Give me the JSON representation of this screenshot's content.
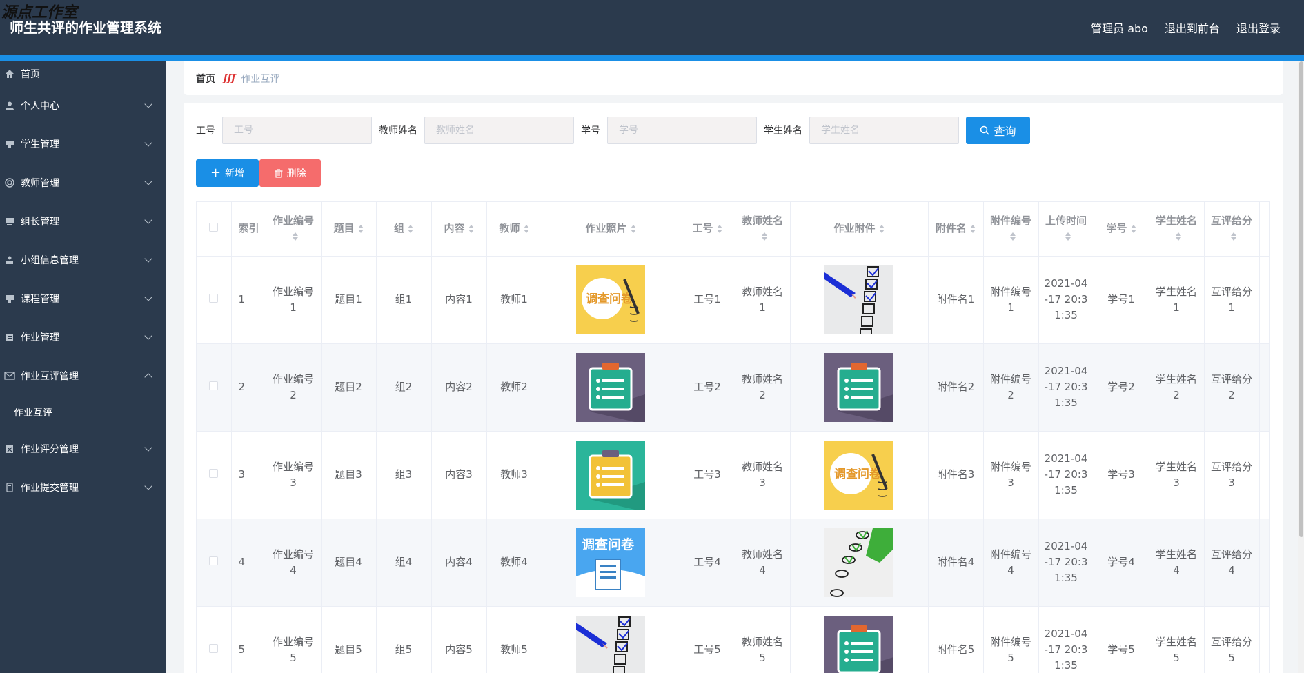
{
  "header": {
    "watermark": "源点工作室",
    "title": "师生共评的作业管理系统",
    "user": "管理员 abo",
    "to_front": "退出到前台",
    "logout": "退出登录"
  },
  "sidebar": {
    "items": [
      {
        "label": "首页",
        "icon": "home-icon"
      },
      {
        "label": "个人中心",
        "icon": "user-icon"
      },
      {
        "label": "学生管理",
        "icon": "student-icon"
      },
      {
        "label": "教师管理",
        "icon": "teacher-icon"
      },
      {
        "label": "组长管理",
        "icon": "group-leader-icon"
      },
      {
        "label": "小组信息管理",
        "icon": "group-info-icon"
      },
      {
        "label": "课程管理",
        "icon": "course-icon"
      },
      {
        "label": "作业管理",
        "icon": "homework-icon"
      },
      {
        "label": "作业互评管理",
        "icon": "mail-icon"
      },
      {
        "label": "作业互评",
        "icon": ""
      },
      {
        "label": "作业评分管理",
        "icon": "score-icon"
      },
      {
        "label": "作业提交管理",
        "icon": "submit-icon"
      }
    ]
  },
  "breadcrumb": {
    "home": "首页",
    "current": "作业互评"
  },
  "search": {
    "gonghao_label": "工号",
    "gonghao_placeholder": "工号",
    "teacher_label": "教师姓名",
    "teacher_placeholder": "教师姓名",
    "xuehao_label": "学号",
    "xuehao_placeholder": "学号",
    "student_label": "学生姓名",
    "student_placeholder": "学生姓名",
    "query_button": "查询"
  },
  "actions": {
    "add": "新增",
    "delete": "删除"
  },
  "table": {
    "headers": [
      "索引",
      "作业编号",
      "题目",
      "组",
      "内容",
      "教师",
      "作业照片",
      "工号",
      "教师姓名",
      "作业附件",
      "附件名",
      "附件编号",
      "上传时间",
      "学号",
      "学生姓名",
      "互评给分"
    ],
    "rows": [
      {
        "idx": "1",
        "bianhao": "作业编号1",
        "timu": "题目1",
        "zu": "组1",
        "neirong": "内容1",
        "jiaoshi": "教师1",
        "photo": "survey-image",
        "gonghao": "工号1",
        "jiaoshixingming": "教师姓名1",
        "attach": "checklist-image",
        "fujianming": "附件名1",
        "fujianbianhao": "附件编号1",
        "time": "2021-04-17 20:31:35",
        "xuehao": "学号1",
        "xueshengxingming": "学生姓名1",
        "fen": "互评给分1"
      },
      {
        "idx": "2",
        "bianhao": "作业编号2",
        "timu": "题目2",
        "zu": "组2",
        "neirong": "内容2",
        "jiaoshi": "教师2",
        "photo": "clipboard-purple-image",
        "gonghao": "工号2",
        "jiaoshixingming": "教师姓名2",
        "attach": "clipboard-purple-image",
        "fujianming": "附件名2",
        "fujianbianhao": "附件编号2",
        "time": "2021-04-17 20:31:35",
        "xuehao": "学号2",
        "xueshengxingming": "学生姓名2",
        "fen": "互评给分2"
      },
      {
        "idx": "3",
        "bianhao": "作业编号3",
        "timu": "题目3",
        "zu": "组3",
        "neirong": "内容3",
        "jiaoshi": "教师3",
        "photo": "clipboard-teal-image",
        "gonghao": "工号3",
        "jiaoshixingming": "教师姓名3",
        "attach": "survey-image",
        "fujianming": "附件名3",
        "fujianbianhao": "附件编号3",
        "time": "2021-04-17 20:31:35",
        "xuehao": "学号3",
        "xueshengxingming": "学生姓名3",
        "fen": "互评给分3"
      },
      {
        "idx": "4",
        "bianhao": "作业编号4",
        "timu": "题目4",
        "zu": "组4",
        "neirong": "内容4",
        "jiaoshi": "教师4",
        "photo": "survey-blue-image",
        "gonghao": "工号4",
        "jiaoshixingming": "教师姓名4",
        "attach": "checkmark-green-image",
        "fujianming": "附件名4",
        "fujianbianhao": "附件编号4",
        "time": "2021-04-17 20:31:35",
        "xuehao": "学号4",
        "xueshengxingming": "学生姓名4",
        "fen": "互评给分4"
      },
      {
        "idx": "5",
        "bianhao": "作业编号5",
        "timu": "题目5",
        "zu": "组5",
        "neirong": "内容5",
        "jiaoshi": "教师5",
        "photo": "checklist-image",
        "gonghao": "工号5",
        "jiaoshixingming": "教师姓名5",
        "attach": "clipboard-purple-image",
        "fujianming": "附件名5",
        "fujianbianhao": "附件编号5",
        "time": "2021-04-17 20:31:35",
        "xuehao": "学号5",
        "xueshengxingming": "学生姓名5",
        "fen": "互评给分5"
      }
    ]
  },
  "thumb_texts": {
    "survey": "调查问卷"
  },
  "colors": {
    "header_bg": "#2b3a4d",
    "accent": "#1a8fe6",
    "danger": "#f56c6c"
  }
}
